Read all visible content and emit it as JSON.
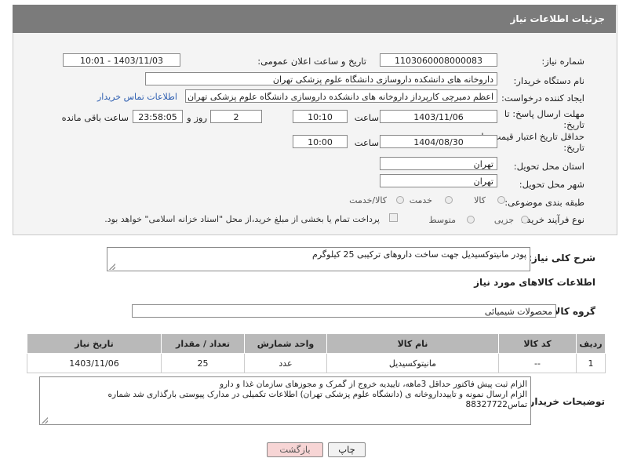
{
  "panel": {
    "title": "جزئیات اطلاعات نیاز"
  },
  "form": {
    "need_number_label": "شماره نیاز:",
    "need_number": "1103060008000083",
    "announce_label": "تاریخ و ساعت اعلان عمومی:",
    "announce_value": "1403/11/03 - 10:01",
    "buyer_org_label": "نام دستگاه خریدار:",
    "buyer_org": "داروخانه های دانشکده داروسازی دانشگاه علوم پزشکی تهران",
    "creator_label": "ایجاد کننده درخواست:",
    "creator": "اعظم دمیرچی کارپرداز داروخانه های دانشکده داروسازی دانشگاه علوم پزشکی تهران",
    "contact_link": "اطلاعات تماس خریدار",
    "deadline_label_1": "مهلت ارسال پاسخ: تا",
    "deadline_label_2": "تاریخ:",
    "deadline_date": "1403/11/06",
    "time_label": "ساعت",
    "deadline_time": "10:10",
    "days_value": "2",
    "days_label": "روز و",
    "remaining_time": "23:58:05",
    "remaining_label": "ساعت باقی مانده",
    "validity_label_1": "حداقل تاریخ اعتبار قیمت: تا",
    "validity_label_2": "تاریخ:",
    "validity_date": "1404/08/30",
    "validity_time": "10:00",
    "province_label": "استان محل تحویل:",
    "province": "تهران",
    "city_label": "شهر محل تحویل:",
    "city": "تهران",
    "category_label": "طبقه بندی موضوعی:",
    "category_options": [
      "کالا",
      "خدمت",
      "کالا/خدمت"
    ],
    "category_selected": "کالا",
    "process_label": "نوع فرآیند خرید :",
    "process_options": [
      "جزیی",
      "متوسط"
    ],
    "payment_note": "پرداخت تمام یا بخشی از مبلغ خرید،از محل \"اسناد خزانه اسلامی\" خواهد بود."
  },
  "summary": {
    "label": "شرح کلی نیاز:",
    "text": "پودر مانیتوکسیدیل جهت ساخت داروهای ترکیبی 25 کیلوگرم"
  },
  "goods": {
    "section_title": "اطلاعات کالاهای مورد نیاز",
    "group_label": "گروه کالا:",
    "group_value": "محصولات شیمیائی",
    "columns": [
      "ردیف",
      "کد کالا",
      "نام کالا",
      "واحد شمارش",
      "تعداد / مقدار",
      "تاریخ نیاز"
    ],
    "rows": [
      [
        "1",
        "--",
        "مانیتوکسیدیل",
        "عدد",
        "25",
        "1403/11/06"
      ]
    ]
  },
  "buyer_notes": {
    "label": "توضیحات خریدار:",
    "line1": "الزام ثبت پیش فاکتور حداقل 3ماهه، تاییدیه خروج از گمرک و مجوزهای سازمان غذا و دارو",
    "line2": "الزام ارسال نمونه و تاییدداروخانه ی (دانشگاه علوم پزشکی تهران) اطلاعات تکمیلی در مدارک پیوستی بارگذاری شد  شماره",
    "line3": "تماس88327722"
  },
  "buttons": {
    "print": "چاپ",
    "back": "بازگشت"
  },
  "colors": {
    "header_bg": "#7b7b7b",
    "table_header_bg": "#b9b9b9",
    "link": "#2c5db0",
    "back_button_bg": "#f7d5d5"
  }
}
